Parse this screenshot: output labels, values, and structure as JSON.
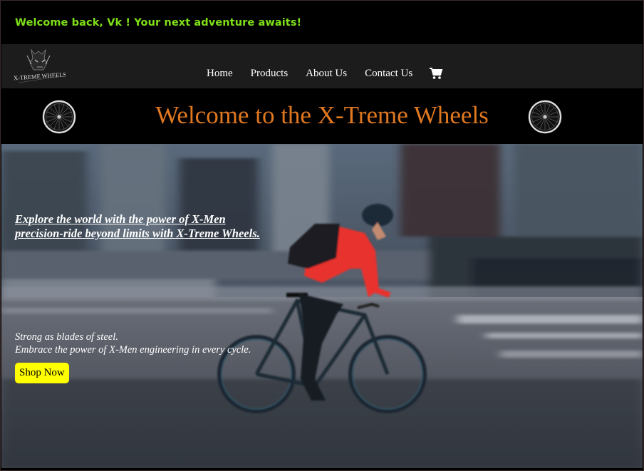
{
  "greeting": {
    "text": "Welcome back, Vk ! Your next adventure awaits!",
    "color": "#7fe018"
  },
  "brand": {
    "logo_text": "X-TREME WHEELS"
  },
  "nav": {
    "items": [
      {
        "label": "Home"
      },
      {
        "label": "Products"
      },
      {
        "label": "About Us"
      },
      {
        "label": "Contact Us"
      }
    ],
    "cart_icon": "shopping-cart-icon"
  },
  "header": {
    "title": "Welcome to the X-Treme Wheels",
    "title_color": "#e07820",
    "icons": [
      "bicycle-wheel-icon",
      "bicycle-wheel-icon"
    ]
  },
  "hero": {
    "headline_line1": "Explore the world with the power of X-Men",
    "headline_line2": "precision-ride beyond limits with X-Treme Wheels.",
    "sub_line1": "Strong as blades of steel.",
    "sub_line2": "Embrace the power of X-Men engineering in every cycle.",
    "cta_label": "Shop Now",
    "cta_color": "#ffff00"
  }
}
